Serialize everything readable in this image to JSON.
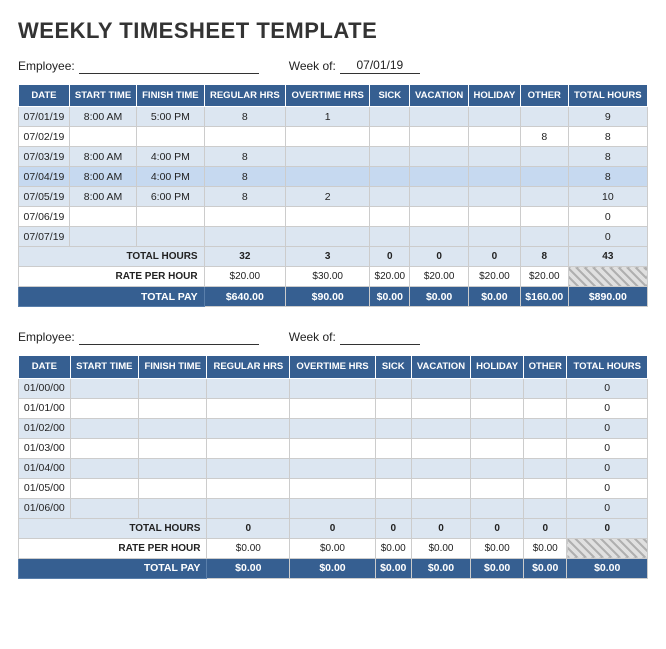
{
  "title": "WEEKLY TIMESHEET TEMPLATE",
  "section1": {
    "employee_label": "Employee:",
    "employee_value": "",
    "week_label": "Week of:",
    "week_value": "07/01/19",
    "columns": [
      "DATE",
      "START TIME",
      "FINISH TIME",
      "REGULAR HRS",
      "OVERTIME HRS",
      "SICK",
      "VACATION",
      "HOLIDAY",
      "OTHER",
      "TOTAL HOURS"
    ],
    "rows": [
      {
        "date": "07/01/19",
        "start": "8:00 AM",
        "finish": "5:00 PM",
        "regular": "8",
        "overtime": "1",
        "sick": "",
        "vacation": "",
        "holiday": "",
        "other": "",
        "total": "9",
        "style": "even"
      },
      {
        "date": "07/02/19",
        "start": "",
        "finish": "",
        "regular": "",
        "overtime": "",
        "sick": "",
        "vacation": "",
        "holiday": "",
        "other": "8",
        "total": "8",
        "style": "odd"
      },
      {
        "date": "07/03/19",
        "start": "8:00 AM",
        "finish": "4:00 PM",
        "regular": "8",
        "overtime": "",
        "sick": "",
        "vacation": "",
        "holiday": "",
        "other": "",
        "total": "8",
        "style": "even"
      },
      {
        "date": "07/04/19",
        "start": "8:00 AM",
        "finish": "4:00 PM",
        "regular": "8",
        "overtime": "",
        "sick": "",
        "vacation": "",
        "holiday": "",
        "other": "",
        "total": "8",
        "style": "highlight"
      },
      {
        "date": "07/05/19",
        "start": "8:00 AM",
        "finish": "6:00 PM",
        "regular": "8",
        "overtime": "2",
        "sick": "",
        "vacation": "",
        "holiday": "",
        "other": "",
        "total": "10",
        "style": "even"
      },
      {
        "date": "07/06/19",
        "start": "",
        "finish": "",
        "regular": "",
        "overtime": "",
        "sick": "",
        "vacation": "",
        "holiday": "",
        "other": "",
        "total": "0",
        "style": "odd"
      },
      {
        "date": "07/07/19",
        "start": "",
        "finish": "",
        "regular": "",
        "overtime": "",
        "sick": "",
        "vacation": "",
        "holiday": "",
        "other": "",
        "total": "0",
        "style": "even"
      }
    ],
    "totals": {
      "label": "TOTAL HOURS",
      "regular": "32",
      "overtime": "3",
      "sick": "0",
      "vacation": "0",
      "holiday": "0",
      "other": "8",
      "total": "43"
    },
    "rates": {
      "label": "RATE PER HOUR",
      "regular": "$20.00",
      "overtime": "$30.00",
      "sick": "$20.00",
      "vacation": "$20.00",
      "holiday": "$20.00",
      "other": "$20.00"
    },
    "pay": {
      "label": "TOTAL PAY",
      "regular": "$640.00",
      "overtime": "$90.00",
      "sick": "$0.00",
      "vacation": "$0.00",
      "holiday": "$0.00",
      "other": "$160.00",
      "total": "$890.00"
    }
  },
  "section2": {
    "employee_label": "Employee:",
    "employee_value": "",
    "week_label": "Week of:",
    "week_value": "",
    "columns": [
      "DATE",
      "START TIME",
      "FINISH TIME",
      "REGULAR HRS",
      "OVERTIME HRS",
      "SICK",
      "VACATION",
      "HOLIDAY",
      "OTHER",
      "TOTAL HOURS"
    ],
    "rows": [
      {
        "date": "01/00/00",
        "start": "",
        "finish": "",
        "regular": "",
        "overtime": "",
        "sick": "",
        "vacation": "",
        "holiday": "",
        "other": "",
        "total": "0",
        "style": "even"
      },
      {
        "date": "01/01/00",
        "start": "",
        "finish": "",
        "regular": "",
        "overtime": "",
        "sick": "",
        "vacation": "",
        "holiday": "",
        "other": "",
        "total": "0",
        "style": "odd"
      },
      {
        "date": "01/02/00",
        "start": "",
        "finish": "",
        "regular": "",
        "overtime": "",
        "sick": "",
        "vacation": "",
        "holiday": "",
        "other": "",
        "total": "0",
        "style": "even"
      },
      {
        "date": "01/03/00",
        "start": "",
        "finish": "",
        "regular": "",
        "overtime": "",
        "sick": "",
        "vacation": "",
        "holiday": "",
        "other": "",
        "total": "0",
        "style": "odd"
      },
      {
        "date": "01/04/00",
        "start": "",
        "finish": "",
        "regular": "",
        "overtime": "",
        "sick": "",
        "vacation": "",
        "holiday": "",
        "other": "",
        "total": "0",
        "style": "even"
      },
      {
        "date": "01/05/00",
        "start": "",
        "finish": "",
        "regular": "",
        "overtime": "",
        "sick": "",
        "vacation": "",
        "holiday": "",
        "other": "",
        "total": "0",
        "style": "odd"
      },
      {
        "date": "01/06/00",
        "start": "",
        "finish": "",
        "regular": "",
        "overtime": "",
        "sick": "",
        "vacation": "",
        "holiday": "",
        "other": "",
        "total": "0",
        "style": "even"
      }
    ],
    "totals": {
      "label": "TOTAL HOURS",
      "regular": "0",
      "overtime": "0",
      "sick": "0",
      "vacation": "0",
      "holiday": "0",
      "other": "0",
      "total": "0"
    },
    "rates": {
      "label": "RATE PER HOUR",
      "regular": "$0.00",
      "overtime": "$0.00",
      "sick": "$0.00",
      "vacation": "$0.00",
      "holiday": "$0.00",
      "other": "$0.00"
    },
    "pay": {
      "label": "TOTAL PAY",
      "regular": "$0.00",
      "overtime": "$0.00",
      "sick": "$0.00",
      "vacation": "$0.00",
      "holiday": "$0.00",
      "other": "$0.00",
      "total": "$0.00"
    }
  }
}
